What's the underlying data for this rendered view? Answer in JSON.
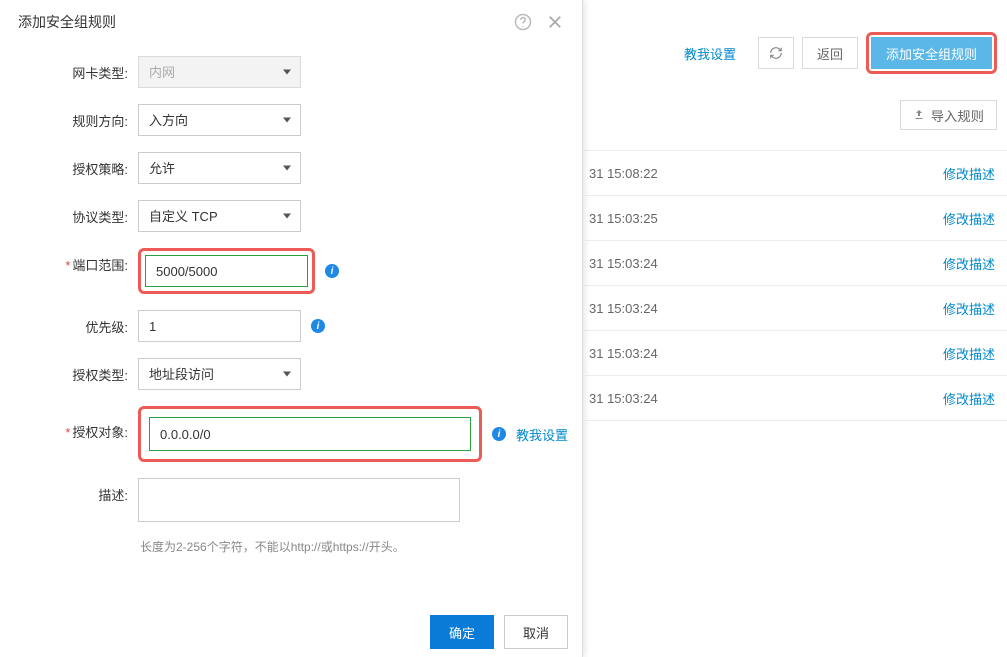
{
  "bg": {
    "teach": "教我设置",
    "back": "返回",
    "add_rule": "添加安全组规则",
    "import_rules": "导入规则",
    "rows": [
      {
        "time": "31 15:08:22",
        "action": "修改描述"
      },
      {
        "time": "31 15:03:25",
        "action": "修改描述"
      },
      {
        "time": "31 15:03:24",
        "action": "修改描述"
      },
      {
        "time": "31 15:03:24",
        "action": "修改描述"
      },
      {
        "time": "31 15:03:24",
        "action": "修改描述"
      },
      {
        "time": "31 15:03:24",
        "action": "修改描述"
      }
    ]
  },
  "dialog": {
    "title": "添加安全组规则",
    "labels": {
      "nic_type": "网卡类型:",
      "rule_dir": "规则方向:",
      "auth_policy": "授权策略:",
      "proto_type": "协议类型:",
      "port_range": "端口范围:",
      "priority": "优先级:",
      "auth_type": "授权类型:",
      "auth_object": "授权对象:",
      "description": "描述:"
    },
    "values": {
      "nic_type": "内网",
      "rule_dir": "入方向",
      "auth_policy": "允许",
      "proto_type": "自定义 TCP",
      "port_range": "5000/5000",
      "priority": "1",
      "auth_type": "地址段访问",
      "auth_object": "0.0.0.0/0",
      "description": ""
    },
    "teach_me": "教我设置",
    "desc_hint": "长度为2-256个字符，不能以http://或https://开头。",
    "ok": "确定",
    "cancel": "取消"
  }
}
